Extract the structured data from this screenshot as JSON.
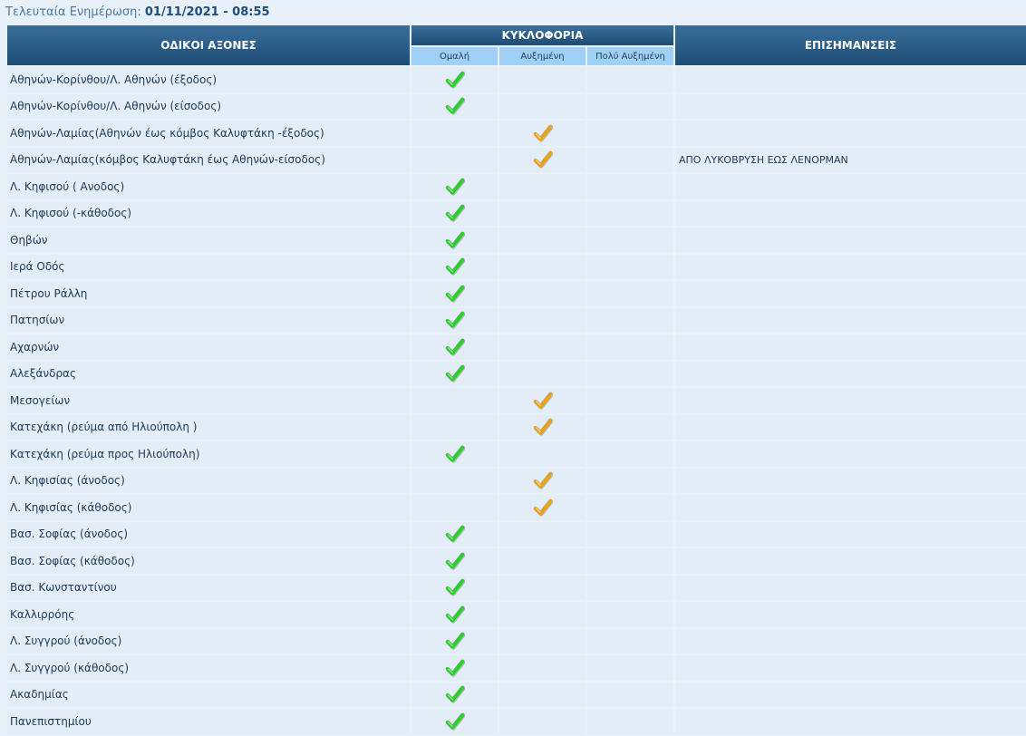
{
  "update": {
    "label": "Τελευταία Ενημέρωση:",
    "value": "01/11/2021 - 08:55"
  },
  "headers": {
    "axes": "ΟΔΙΚΟΙ ΑΞΟΝΕΣ",
    "traffic": "ΚΥΚΛΟΦΟΡΙΑ",
    "notes": "ΕΠΙΣΗΜΑΝΣΕΙΣ",
    "normal": "Ομαλή",
    "increased": "Αυξημένη",
    "very_increased": "Πολύ Αυξημένη"
  },
  "status_colors": {
    "normal": "#2fcb2f",
    "increased": "#e8a21a"
  },
  "rows": [
    {
      "name": "Αθηνών-Κορίνθου/Λ. Αθηνών (έξοδος)",
      "status": "normal",
      "note": ""
    },
    {
      "name": "Αθηνών-Κορίνθου/Λ. Αθηνών (είσοδος)",
      "status": "normal",
      "note": ""
    },
    {
      "name": "Αθηνών-Λαμίας(Αθηνών έως κόμβος Καλυφτάκη -έξοδος)",
      "status": "increased",
      "note": ""
    },
    {
      "name": "Αθηνών-Λαμίας(κόμβος Καλυφτάκη έως Αθηνών-είσοδος)",
      "status": "increased",
      "note": "ΑΠΟ ΛΥΚΟΒΡΥΣΗ ΕΩΣ ΛΕΝΟΡΜΑΝ"
    },
    {
      "name": "Λ. Κηφισού ( Ανοδος)",
      "status": "normal",
      "note": ""
    },
    {
      "name": "Λ. Κηφισού (-κάθοδος)",
      "status": "normal",
      "note": ""
    },
    {
      "name": "Θηβών",
      "status": "normal",
      "note": ""
    },
    {
      "name": "Ιερά Οδός",
      "status": "normal",
      "note": ""
    },
    {
      "name": "Πέτρου Ράλλη",
      "status": "normal",
      "note": ""
    },
    {
      "name": "Πατησίων",
      "status": "normal",
      "note": ""
    },
    {
      "name": "Αχαρνών",
      "status": "normal",
      "note": ""
    },
    {
      "name": "Αλεξάνδρας",
      "status": "normal",
      "note": ""
    },
    {
      "name": "Μεσογείων",
      "status": "increased",
      "note": ""
    },
    {
      "name": "Κατεχάκη (ρεύμα από Ηλιούπολη )",
      "status": "increased",
      "note": ""
    },
    {
      "name": "Κατεχάκη (ρεύμα προς Ηλιούπολη)",
      "status": "normal",
      "note": ""
    },
    {
      "name": "Λ. Κηφισίας (άνοδος)",
      "status": "increased",
      "note": ""
    },
    {
      "name": "Λ. Κηφισίας (κάθοδος)",
      "status": "increased",
      "note": ""
    },
    {
      "name": "Βασ. Σοφίας (άνοδος)",
      "status": "normal",
      "note": ""
    },
    {
      "name": "Βασ. Σοφίας (κάθοδος)",
      "status": "normal",
      "note": ""
    },
    {
      "name": "Βασ. Κωνσταντίνου",
      "status": "normal",
      "note": ""
    },
    {
      "name": "Καλλιρρόης",
      "status": "normal",
      "note": ""
    },
    {
      "name": "Λ. Συγγρού (άνοδος)",
      "status": "normal",
      "note": ""
    },
    {
      "name": "Λ. Συγγρού (κάθοδος)",
      "status": "normal",
      "note": ""
    },
    {
      "name": "Ακαδημίας",
      "status": "normal",
      "note": ""
    },
    {
      "name": "Πανεπιστημίου",
      "status": "normal",
      "note": ""
    }
  ]
}
